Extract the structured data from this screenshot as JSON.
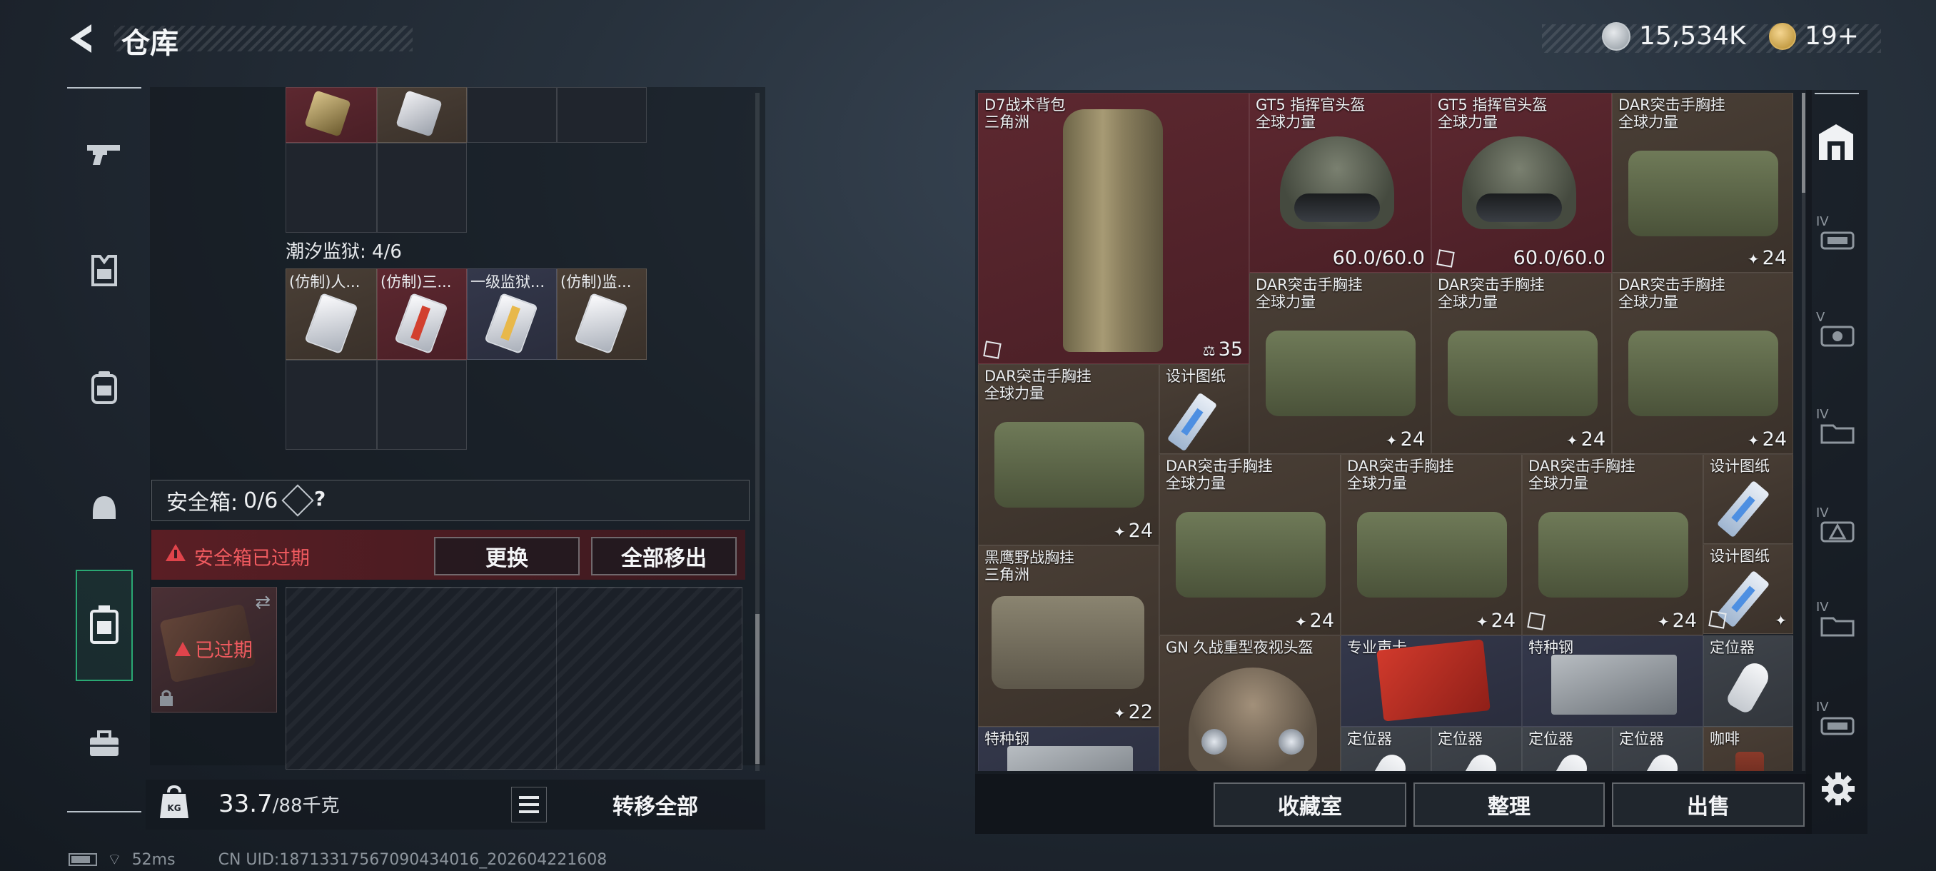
{
  "header": {
    "title": "仓库",
    "currency": "15,534K",
    "tickets": "19+"
  },
  "sidebar": {
    "items": [
      {
        "name": "weapons"
      },
      {
        "name": "armor"
      },
      {
        "name": "backpack"
      },
      {
        "name": "chest-rig"
      },
      {
        "name": "safe-box",
        "active": true
      },
      {
        "name": "toolbox"
      }
    ]
  },
  "loadout": {
    "section_label": "潮汐监狱: 4/6",
    "section_cards": [
      "(仿制)人...",
      "(仿制)三...",
      "一级监狱...",
      "(仿制)监..."
    ],
    "safe_box_label": "安全箱:",
    "safe_box_count": "0/6",
    "help": "?",
    "expired_msg": "安全箱已过期",
    "replace_btn": "更换",
    "move_all_out_btn": "全部移出",
    "expired_badge": "已过期"
  },
  "footer": {
    "weight": "33.7",
    "max_weight": "/88千克",
    "transfer_all_btn": "转移全部"
  },
  "status": {
    "ping": "52ms",
    "uid": "CN UID:18713317567090434016_202604221608"
  },
  "warehouse": {
    "items": [
      {
        "name": "D7战术背包",
        "sub": "三角洲",
        "count": "35",
        "rarity": "red"
      },
      {
        "name": "GT5 指挥官头盔",
        "sub": "全球力量",
        "count": "60.0/60.0",
        "rarity": "red"
      },
      {
        "name": "GT5 指挥官头盔",
        "sub": "全球力量",
        "count": "60.0/60.0",
        "rarity": "red"
      },
      {
        "name": "DAR突击手胸挂",
        "sub": "全球力量",
        "count": "24",
        "rarity": "brown"
      },
      {
        "name": "DAR突击手胸挂",
        "sub": "全球力量",
        "count": "24",
        "rarity": "brown"
      },
      {
        "name": "DAR突击手胸挂",
        "sub": "全球力量",
        "count": "24",
        "rarity": "brown"
      },
      {
        "name": "DAR突击手胸挂",
        "sub": "全球力量",
        "count": "24",
        "rarity": "brown"
      },
      {
        "name": "DAR突击手胸挂",
        "sub": "全球力量",
        "count": "24",
        "rarity": "brown"
      },
      {
        "name": "设计图纸",
        "sub": "",
        "count": "",
        "rarity": "brown"
      },
      {
        "name": "DAR突击手胸挂",
        "sub": "全球力量",
        "count": "24",
        "rarity": "brown"
      },
      {
        "name": "DAR突击手胸挂",
        "sub": "全球力量",
        "count": "24",
        "rarity": "brown"
      },
      {
        "name": "DAR突击手胸挂",
        "sub": "全球力量",
        "count": "24",
        "rarity": "brown"
      },
      {
        "name": "设计图纸",
        "sub": "",
        "count": "",
        "rarity": "brown"
      },
      {
        "name": "黑鹰野战胸挂",
        "sub": "三角洲",
        "count": "22",
        "rarity": "brown"
      },
      {
        "name": "设计图纸",
        "sub": "",
        "count": "",
        "rarity": "brown"
      },
      {
        "name": "GN 久战重型夜视头盔",
        "sub": "",
        "count": "",
        "rarity": "brown"
      },
      {
        "name": "专业声卡",
        "sub": "",
        "count": "",
        "rarity": "blue"
      },
      {
        "name": "特种钢",
        "sub": "",
        "count": "",
        "rarity": "blue"
      },
      {
        "name": "定位器",
        "sub": "",
        "count": "",
        "rarity": "gray"
      },
      {
        "name": "特种钢",
        "sub": "",
        "count": "",
        "rarity": "blue"
      },
      {
        "name": "定位器",
        "sub": "",
        "count": "",
        "rarity": "gray"
      },
      {
        "name": "定位器",
        "sub": "",
        "count": "",
        "rarity": "gray"
      },
      {
        "name": "定位器",
        "sub": "",
        "count": "",
        "rarity": "gray"
      },
      {
        "name": "定位器",
        "sub": "",
        "count": "",
        "rarity": "gray"
      },
      {
        "name": "咖啡",
        "sub": "",
        "count": "",
        "rarity": "brown"
      }
    ]
  },
  "actions": {
    "collection_btn": "收藏室",
    "sort_btn": "整理",
    "sell_btn": "出售"
  },
  "right_rail": {
    "tabs": [
      "IV",
      "V",
      "IV",
      "IV",
      "IV",
      "IV"
    ]
  },
  "colors": {
    "red": "#5d2830",
    "brown": "#4a3f36",
    "blue": "#34384b",
    "gray": "#3f444b",
    "alert": "#e0444b"
  }
}
